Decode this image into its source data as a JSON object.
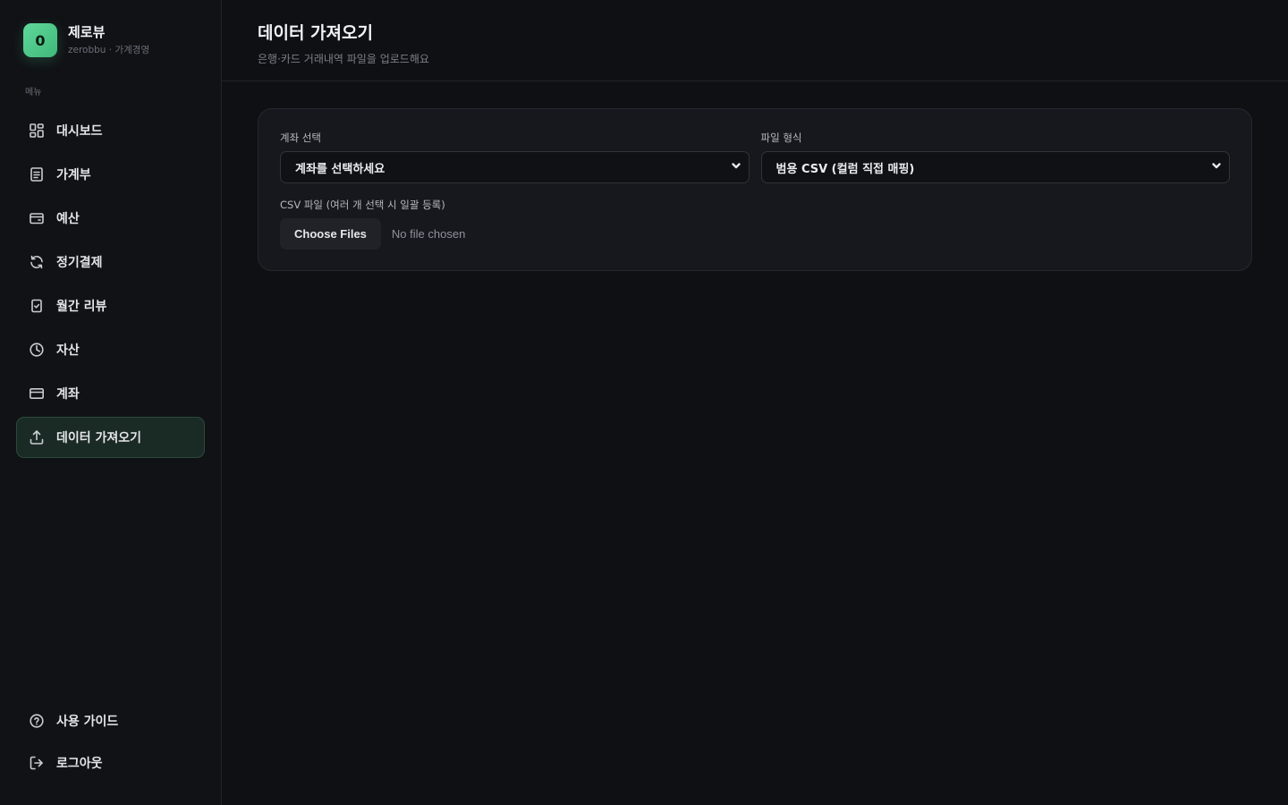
{
  "brand": {
    "logo_letter": "0",
    "name": "제로뷰",
    "subtitle": "zerobbu · 가계경영",
    "accent": "#4fc98a"
  },
  "sidebar": {
    "menu_label": "메뉴",
    "items": [
      {
        "label": "대시보드",
        "icon": "grid-icon",
        "active": false
      },
      {
        "label": "가계부",
        "icon": "document-icon",
        "active": false
      },
      {
        "label": "예산",
        "icon": "wallet-icon",
        "active": false
      },
      {
        "label": "정기결제",
        "icon": "refresh-icon",
        "active": false
      },
      {
        "label": "월간 리뷰",
        "icon": "clipboard-check-icon",
        "active": false
      },
      {
        "label": "자산",
        "icon": "pie-chart-icon",
        "active": false
      },
      {
        "label": "계좌",
        "icon": "credit-card-icon",
        "active": false
      },
      {
        "label": "데이터 가져오기",
        "icon": "upload-icon",
        "active": true
      }
    ],
    "bottom": [
      {
        "label": "사용 가이드",
        "icon": "help-circle-icon"
      },
      {
        "label": "로그아웃",
        "icon": "logout-icon"
      }
    ]
  },
  "header": {
    "title": "데이터 가져오기",
    "subtitle": "은행·카드 거래내역 파일을 업로드해요"
  },
  "form": {
    "account_label": "계좌 선택",
    "account_value": "계좌를 선택하세요",
    "format_label": "파일 형식",
    "format_value": "범용 CSV (컬럼 직접 매핑)",
    "file_label": "CSV 파일 (여러 개 선택 시 일괄 등록)",
    "file_button": "Choose Files",
    "file_status": "No file chosen"
  }
}
